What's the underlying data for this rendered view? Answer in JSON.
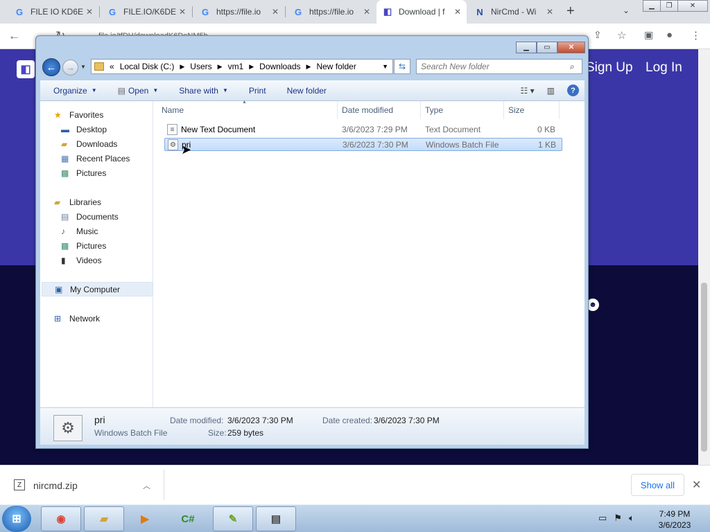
{
  "browser": {
    "tabs": [
      {
        "label": "FILE IO KD6E",
        "favicon": "G",
        "active": false
      },
      {
        "label": "FILE.IO/K6DE",
        "favicon": "G",
        "active": false
      },
      {
        "label": "https://file.io",
        "favicon": "G",
        "active": false
      },
      {
        "label": "https://file.io",
        "favicon": "G",
        "active": false
      },
      {
        "label": "Download | f",
        "favicon": "file-io-icon",
        "active": true
      },
      {
        "label": "NirCmd - Wi",
        "favicon": "N",
        "active": false
      }
    ],
    "address": "file.io/tfDH/downloadK6DeNM5b..."
  },
  "site": {
    "signup": "Sign Up",
    "login": "Log In"
  },
  "explorer": {
    "breadcrumb": [
      "Local Disk (C:)",
      "Users",
      "vm1",
      "Downloads",
      "New folder"
    ],
    "breadcrumb_prefix": "«",
    "search_placeholder": "Search New folder",
    "commands": {
      "organize": "Organize",
      "open": "Open",
      "share_with": "Share with",
      "print": "Print",
      "new_folder": "New folder"
    },
    "nav": {
      "favorites": "Favorites",
      "desktop": "Desktop",
      "downloads": "Downloads",
      "recent": "Recent Places",
      "pictures_fav": "Pictures",
      "libraries": "Libraries",
      "documents": "Documents",
      "music": "Music",
      "pictures_lib": "Pictures",
      "videos": "Videos",
      "my_computer": "My Computer",
      "network": "Network"
    },
    "columns": {
      "name": "Name",
      "date": "Date modified",
      "type": "Type",
      "size": "Size"
    },
    "files": [
      {
        "name": "New Text Document",
        "date": "3/6/2023 7:29 PM",
        "type": "Text Document",
        "size": "0 KB",
        "selected": false
      },
      {
        "name": "pri",
        "date": "3/6/2023 7:30 PM",
        "type": "Windows Batch File",
        "size": "1 KB",
        "selected": true
      }
    ],
    "details": {
      "name": "pri",
      "type": "Windows Batch File",
      "date_modified_label": "Date modified:",
      "date_modified": "3/6/2023 7:30 PM",
      "date_created_label": "Date created:",
      "date_created": "3/6/2023 7:30 PM",
      "size_label": "Size:",
      "size": "259 bytes"
    }
  },
  "downloads": {
    "file": "nircmd.zip",
    "show_all": "Show all"
  },
  "taskbar": {
    "time": "7:49 PM",
    "date": "3/6/2023"
  },
  "colors": {
    "site_band": "#3a36a8",
    "site_dark": "#0c0b3a",
    "accent": "#1a73e8"
  }
}
